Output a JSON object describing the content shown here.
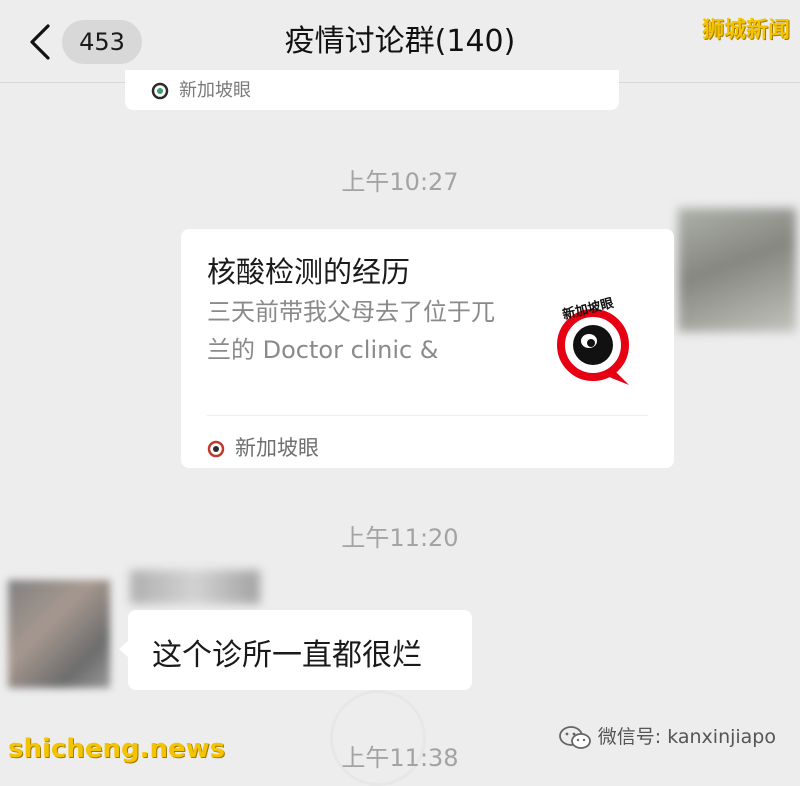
{
  "header": {
    "back_icon": "chevron-left-icon",
    "unread_count": "453",
    "title": "疫情讨论群(140)",
    "more_icon": "more-dots-icon"
  },
  "watermarks": {
    "top_right": "狮城新闻",
    "bottom_left": "shicheng.news",
    "bottom_right": "微信号: kanxinjiapo"
  },
  "messages": {
    "prev_card_source": "新加坡眼",
    "time_1": "上午10:27",
    "article": {
      "title": "核酸检测的经历",
      "description": "三天前带我父母去了位于兀兰的 Doctor clinic &",
      "thumb_label": "新加坡眼",
      "source": "新加坡眼"
    },
    "time_2": "上午11:20",
    "text_message": "这个诊所一直都很烂",
    "time_3": "上午11:38"
  },
  "colors": {
    "background": "#ededed",
    "bubble": "#ffffff",
    "brand_red": "#e60012",
    "watermark_yellow": "#f5c400"
  }
}
